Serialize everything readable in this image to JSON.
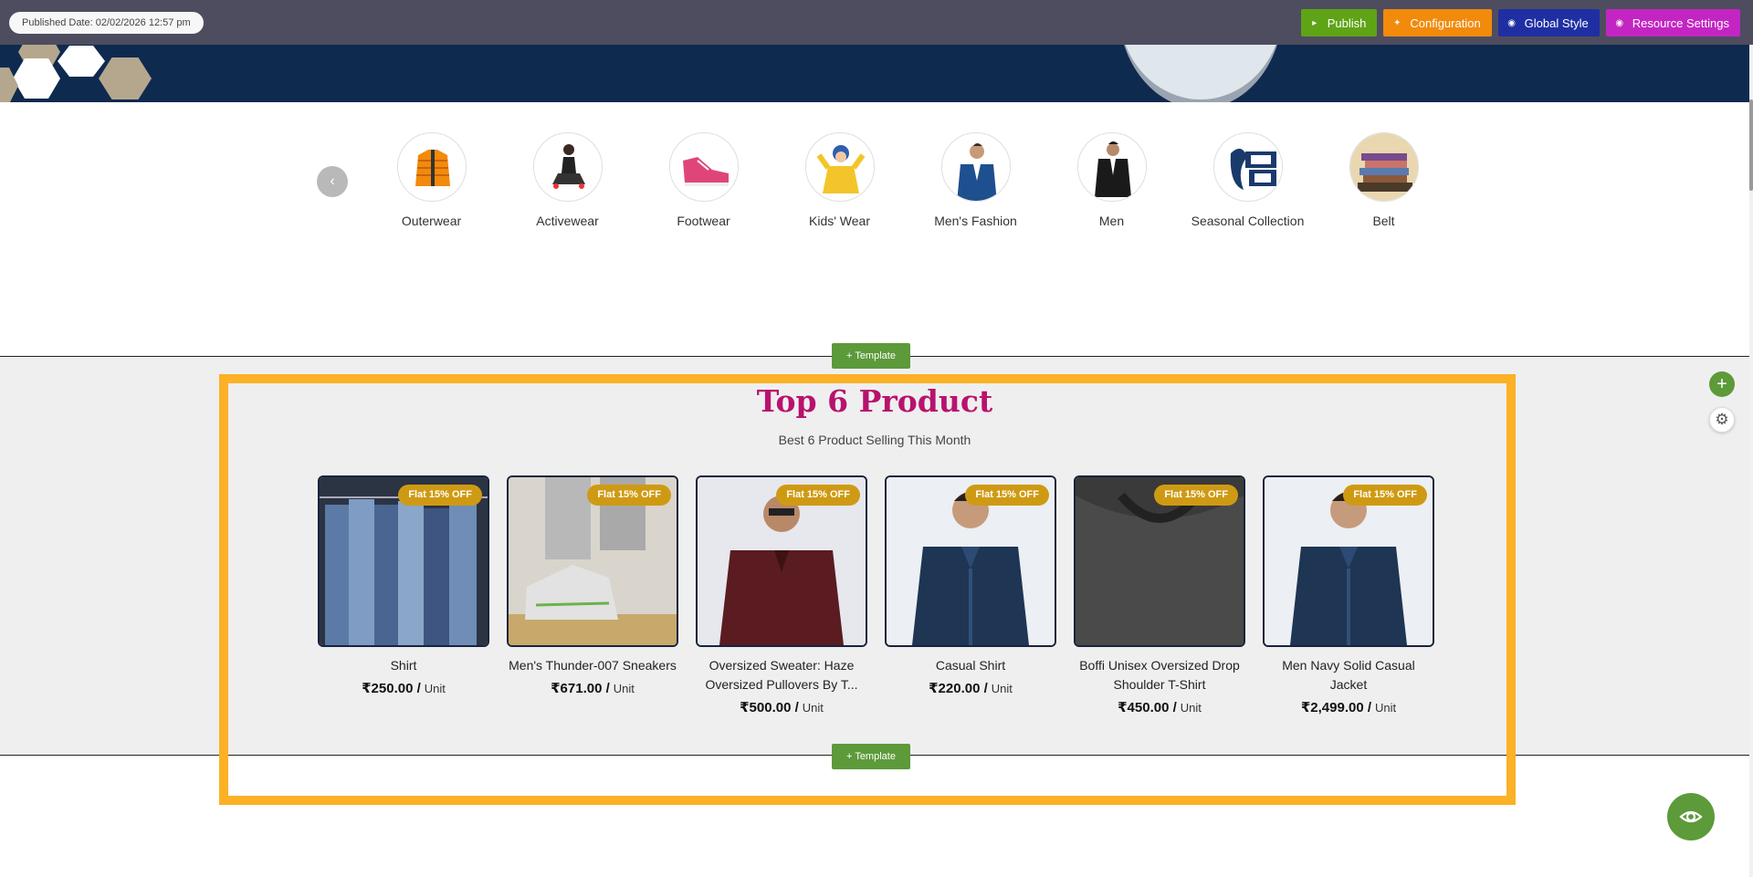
{
  "toolbar": {
    "published_date": "Published Date: 02/02/2026 12:57 pm",
    "publish_label": "Publish",
    "configuration_label": "Configuration",
    "global_style_label": "Global Style",
    "resource_settings_label": "Resource Settings",
    "colors": {
      "publish": "#5fa316",
      "configuration": "#f28a0c",
      "global_style": "#1f2fa3",
      "resource_settings": "#c325c3"
    }
  },
  "categories": {
    "prev_icon": "chevron-left-icon",
    "items": [
      {
        "label": "Outerwear",
        "icon": "puffer-jacket"
      },
      {
        "label": "Activewear",
        "icon": "woman-sitting"
      },
      {
        "label": "Footwear",
        "icon": "pink-sneaker"
      },
      {
        "label": "Kids' Wear",
        "icon": "child-yellow-jacket"
      },
      {
        "label": "Men's Fashion",
        "icon": "man-denim"
      },
      {
        "label": "Men",
        "icon": "man-black-jacket"
      },
      {
        "label": "Seasonal Collection",
        "icon": "outlook-logo"
      },
      {
        "label": "Belt",
        "icon": "books-stack"
      }
    ]
  },
  "template_button_label": "+ Template",
  "section": {
    "title": "Top 6 Product",
    "subtitle": "Best 6 Product Selling This Month",
    "title_color": "#b8126e",
    "frame_color": "#fcb126"
  },
  "products": [
    {
      "name": "Shirt",
      "price": "₹250.00 /",
      "unit": "Unit",
      "badge": "Flat 15% OFF"
    },
    {
      "name": "Men's Thunder-007 Sneakers",
      "price": "₹671.00 /",
      "unit": "Unit",
      "badge": "Flat 15% OFF"
    },
    {
      "name": "Oversized Sweater: Haze Oversized Pullovers By T...",
      "price": "₹500.00 /",
      "unit": "Unit",
      "badge": "Flat 15% OFF"
    },
    {
      "name": "Casual Shirt",
      "price": "₹220.00 /",
      "unit": "Unit",
      "badge": "Flat 15% OFF"
    },
    {
      "name": "Boffi Unisex Oversized Drop Shoulder T-Shirt",
      "price": "₹450.00 /",
      "unit": "Unit",
      "badge": "Flat 15% OFF"
    },
    {
      "name": "Men Navy Solid Casual Jacket",
      "price": "₹2,499.00 /",
      "unit": "Unit",
      "badge": "Flat 15% OFF"
    }
  ],
  "floating": {
    "add_icon": "plus-icon",
    "settings_icon": "gear-icon",
    "preview_icon": "eye-icon"
  }
}
